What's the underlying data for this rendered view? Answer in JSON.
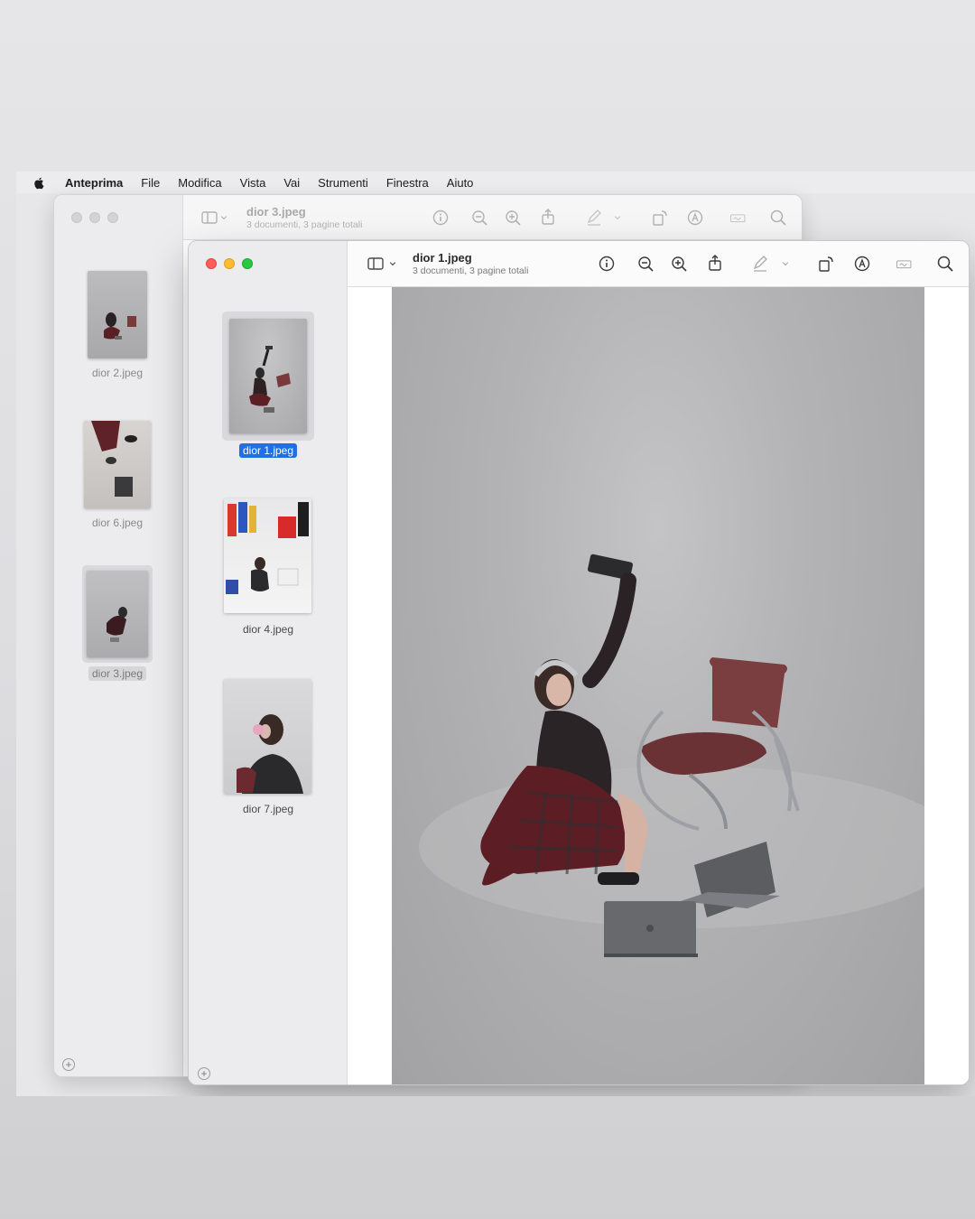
{
  "menubar": {
    "app_name": "Anteprima",
    "items": [
      "File",
      "Modifica",
      "Vista",
      "Vai",
      "Strumenti",
      "Finestra",
      "Aiuto"
    ]
  },
  "back_window": {
    "title": "dior 3.jpeg",
    "subtitle": "3 documenti, 3 pagine totali",
    "thumbnails": [
      {
        "label": "dior 2.jpeg"
      },
      {
        "label": "dior 6.jpeg"
      },
      {
        "label": "dior 3.jpeg"
      }
    ]
  },
  "front_window": {
    "title": "dior 1.jpeg",
    "subtitle": "3 documenti, 3 pagine totali",
    "thumbnails": [
      {
        "label": "dior 1.jpeg",
        "selected": true
      },
      {
        "label": "dior 4.jpeg"
      },
      {
        "label": "dior 7.jpeg"
      }
    ]
  },
  "toolbar_icons": [
    "sidebar-icon",
    "chevron-down-icon",
    "info-icon",
    "zoom-out-icon",
    "zoom-in-icon",
    "share-icon",
    "markup-pen-icon",
    "chevron-down-icon",
    "rotate-icon",
    "annotate-icon",
    "signature-icon",
    "search-icon"
  ],
  "colors": {
    "selection": "#1f6fe5",
    "close": "#ff5f57",
    "minimize": "#febc2e",
    "zoom": "#28c840"
  }
}
